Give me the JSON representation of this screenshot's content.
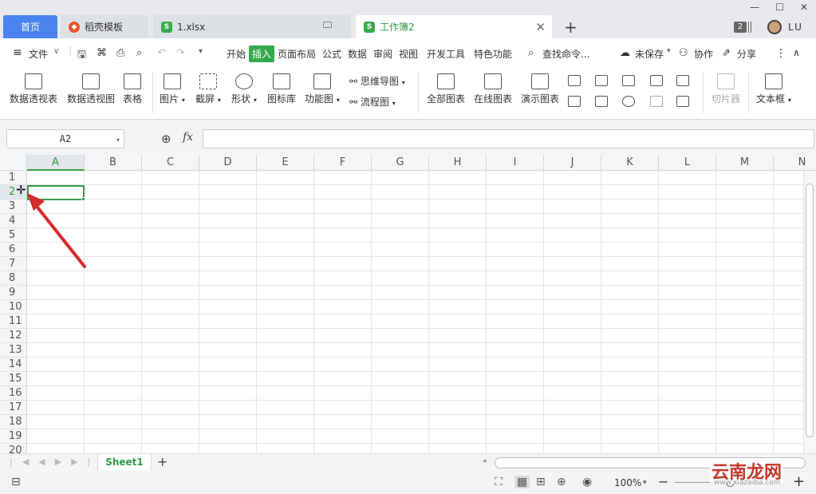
{
  "tabs": {
    "home": "首页",
    "docer": "稻壳模板",
    "xlsx": "1.xlsx",
    "workbook": "工作簿2",
    "new_tab": "+"
  },
  "titlebar": {
    "badge": "2",
    "user": "LU"
  },
  "menubar": {
    "file": "文件",
    "items": [
      "开始",
      "插入",
      "页面布局",
      "公式",
      "数据",
      "审阅",
      "视图",
      "开发工具",
      "特色功能"
    ],
    "search": "查找命令...",
    "unsaved": "未保存",
    "collab": "协作",
    "share": "分享"
  },
  "ribbon": {
    "pivot_table": "数据透视表",
    "pivot_chart": "数据透视图",
    "table": "表格",
    "picture": "图片",
    "screenshot": "截屏",
    "shape": "形状",
    "icon_lib": "图标库",
    "func_chart": "功能图",
    "mindmap": "思维导图",
    "flowchart": "流程图",
    "all_charts": "全部图表",
    "online_charts": "在线图表",
    "demo_charts": "演示图表",
    "slicer": "切片器",
    "textbox": "文本框"
  },
  "formula_bar": {
    "cell_ref": "A2",
    "fx": "fx",
    "value": ""
  },
  "grid": {
    "columns": [
      "A",
      "B",
      "C",
      "D",
      "E",
      "F",
      "G",
      "H",
      "I",
      "J",
      "K",
      "L",
      "M",
      "N"
    ],
    "rows": [
      "1",
      "2",
      "3",
      "4",
      "5",
      "6",
      "7",
      "8",
      "9",
      "10",
      "11",
      "12",
      "13",
      "14",
      "15",
      "16",
      "17",
      "18",
      "19",
      "20"
    ],
    "selected_cell": "A2"
  },
  "sheets": {
    "active": "Sheet1",
    "add": "+"
  },
  "status": {
    "zoom": "100%"
  },
  "watermark": {
    "text": "云南龙网",
    "url": "www.xiazaiba.com"
  },
  "colors": {
    "accent_green": "#36a94c",
    "home_tab_blue": "#4b83f0",
    "arrow_red": "#d62b2b"
  }
}
